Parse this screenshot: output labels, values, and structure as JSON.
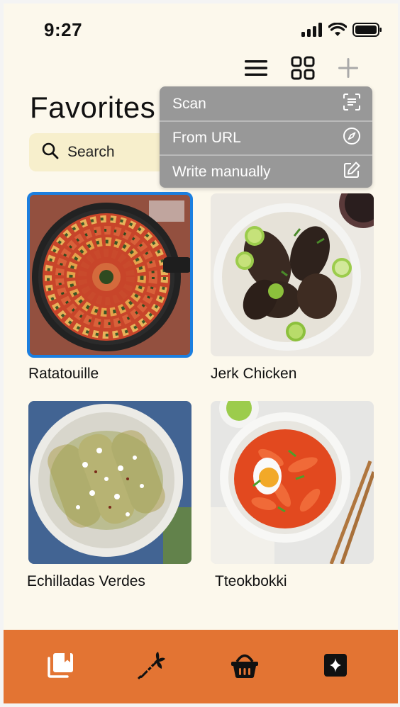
{
  "status_bar": {
    "time": "9:27"
  },
  "toolbar": {
    "menu_icon": "hamburger-icon",
    "grid_icon": "grid-view-icon",
    "add_icon": "plus-icon"
  },
  "page": {
    "title": "Favorites"
  },
  "search": {
    "placeholder": "Search"
  },
  "add_menu": {
    "items": [
      {
        "label": "Scan",
        "icon": "scan-icon"
      },
      {
        "label": "From URL",
        "icon": "compass-icon"
      },
      {
        "label": "Write manually",
        "icon": "edit-icon"
      }
    ]
  },
  "recipes": [
    {
      "name": "Ratatouille",
      "selected": true
    },
    {
      "name": "Jerk Chicken",
      "selected": false
    },
    {
      "name": "Echilladas Verdes",
      "selected": false
    },
    {
      "name": "Tteokbokki",
      "selected": false
    }
  ],
  "bottom_nav": {
    "items": [
      {
        "icon": "recipe-book-icon"
      },
      {
        "icon": "carrot-icon"
      },
      {
        "icon": "basket-icon"
      },
      {
        "icon": "sparkle-icon"
      }
    ]
  },
  "colors": {
    "background": "#fcf8ec",
    "accent_orange": "#e37433",
    "menu_gray": "#989898",
    "selection_blue": "#1b7fe0",
    "search_bg": "#f7efcc"
  }
}
